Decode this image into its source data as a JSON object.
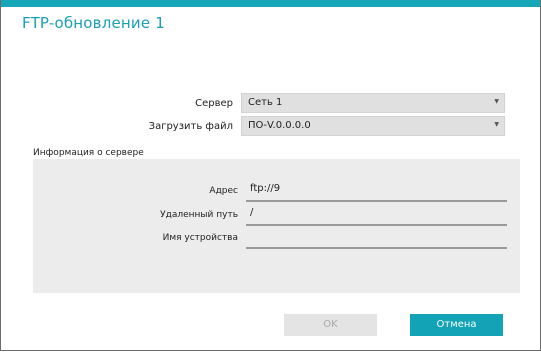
{
  "dialog": {
    "title": "FTP-обновление 1"
  },
  "form": {
    "server_label": "Сервер",
    "server_value": "Сеть 1",
    "upload_file_label": "Загрузить файл",
    "upload_file_value": "ПО-V.0.0.0.0"
  },
  "server_info": {
    "section_label": "Информация о сервере",
    "address_label": "Адрес",
    "address_value": "ftp://9",
    "remote_path_label": "Удаленный путь",
    "remote_path_value": "/",
    "file_name_label": "Имя устройства",
    "file_name_value": ""
  },
  "buttons": {
    "ok_label": "OK",
    "cancel_label": "Отмена"
  },
  "colors": {
    "accent": "#15a6b8",
    "panel": "#ececec"
  },
  "icons": {
    "select_arrow": "dropdown-arrow-icon"
  }
}
